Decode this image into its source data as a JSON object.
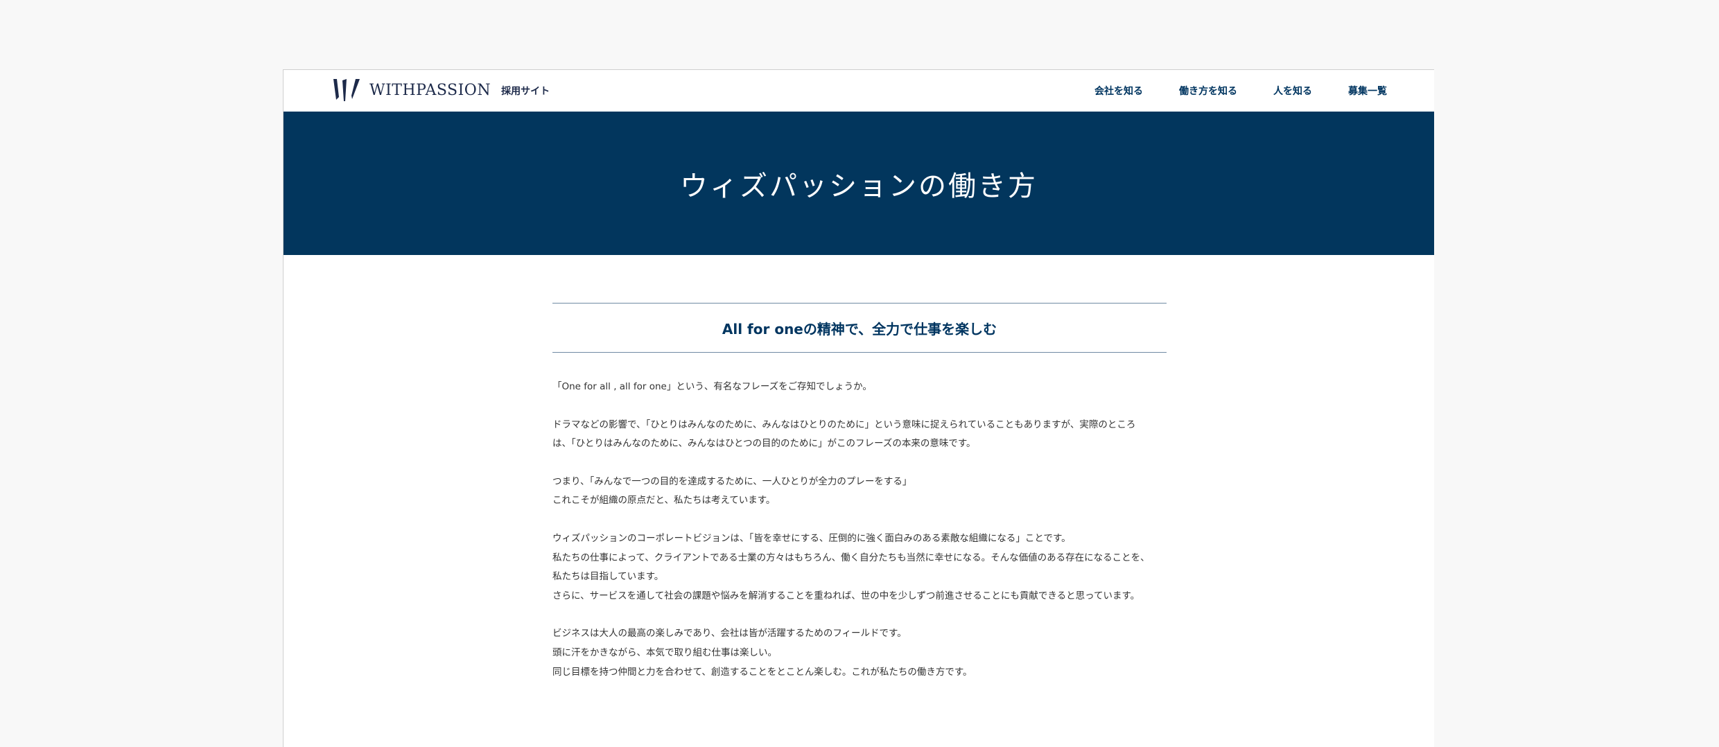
{
  "header": {
    "logo_text": "WITHPASSION",
    "logo_sub": "採用サイト",
    "nav": [
      {
        "label": "会社を知る"
      },
      {
        "label": "働き方を知る"
      },
      {
        "label": "人を知る"
      },
      {
        "label": "募集一覧"
      }
    ]
  },
  "hero": {
    "title": "ウィズパッションの働き方"
  },
  "article": {
    "heading": "All for oneの精神で、全力で仕事を楽しむ",
    "paragraphs": [
      [
        "「One for all , all for one」という、有名なフレーズをご存知でしょうか。"
      ],
      [
        "ドラマなどの影響で、「ひとりはみんなのために、みんなはひとりのために」という意味に捉えられていることもありますが、実際のところ",
        "は、「ひとりはみんなのために、みんなはひとつの目的のために」がこのフレーズの本来の意味です。"
      ],
      [
        "つまり、「みんなで一つの目的を達成するために、一人ひとりが全力のプレーをする」",
        "これこそが組織の原点だと、私たちは考えています。"
      ],
      [
        "ウィズパッションのコーポレートビジョンは、「皆を幸せにする、圧倒的に強く面白みのある素敵な組織になる」ことです。",
        "私たちの仕事によって、クライアントである士業の方々はもちろん、働く自分たちも当然に幸せになる。そんな価値のある存在になることを、",
        "私たちは目指しています。",
        "さらに、サービスを通して社会の課題や悩みを解消することを重ねれば、世の中を少しずつ前進させることにも貢献できると思っています。"
      ],
      [
        "ビジネスは大人の最高の楽しみであり、会社は皆が活躍するためのフィールドです。",
        "頭に汗をかきながら、本気で取り組む仕事は楽しい。",
        "同じ目標を持つ仲間と力を合わせて、創造することをとことん楽しむ。これが私たちの働き方です。"
      ]
    ]
  },
  "colors": {
    "brand_navy": "#02365d",
    "nav_text": "#003560",
    "rule": "#6f8aa3",
    "background": "#f8f8f8"
  }
}
